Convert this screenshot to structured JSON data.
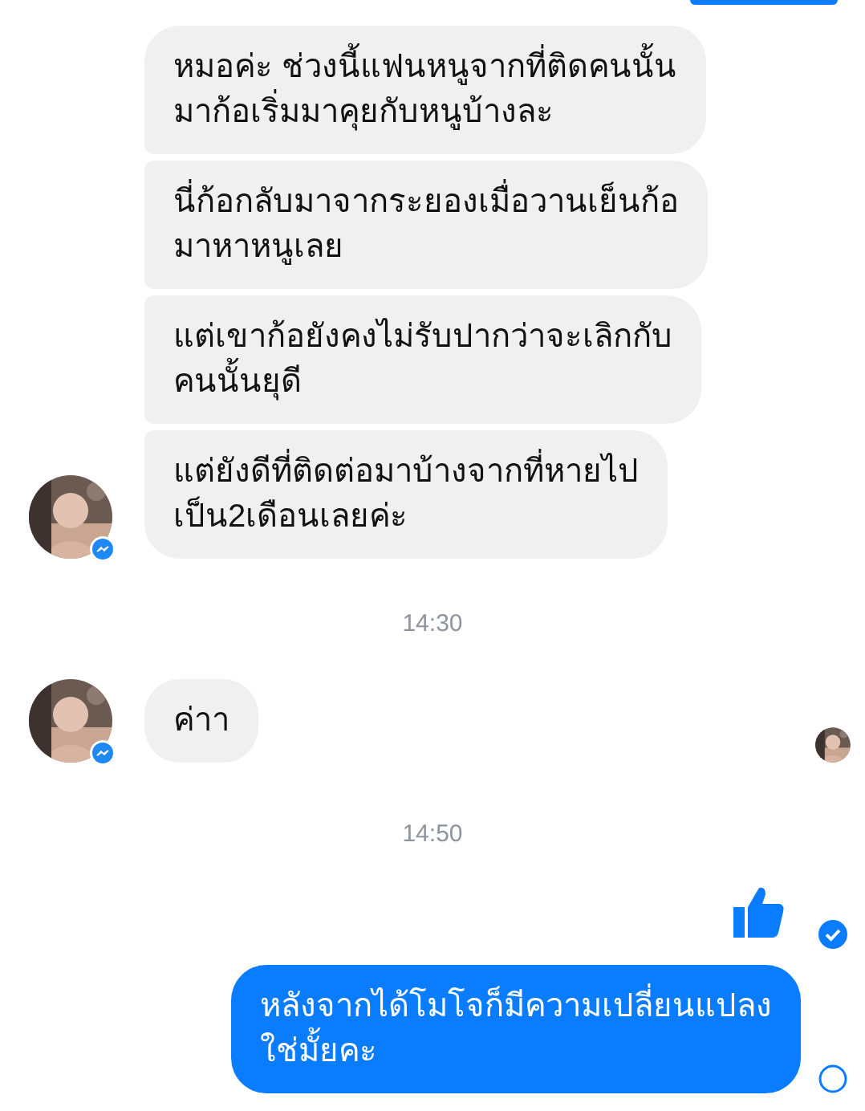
{
  "thread": [
    {
      "kind": "incoming",
      "texts": [
        "หมอค่ะ ช่วงนี้แฟนหนูจากที่ติดคนนั้น\nมาก้อเริ่มมาคุยกับหนูบ้างละ",
        "นี่ก้อกลับมาจากระยองเมื่อวานเย็นก้อ\nมาหาหนูเลย",
        "แต่เขาก้อยังคงไม่รับปากว่าจะเลิกกับ\nคนนั้นยุดี",
        "แต่ยังดีที่ติดต่อมาบ้างจากที่หายไป\nเป็น2เดือนเลยค่ะ"
      ],
      "seen_avatar": false
    },
    {
      "kind": "time",
      "text": "14:30"
    },
    {
      "kind": "incoming",
      "texts": [
        "ค่าา"
      ],
      "seen_avatar": true
    },
    {
      "kind": "time",
      "text": "14:50"
    },
    {
      "kind": "like",
      "delivered": true
    },
    {
      "kind": "outgoing",
      "texts": [
        "หลังจากได้โมโจก็มีความเปลี่ยนแปลง\nใช่มั้ยคะ"
      ],
      "delivered": false
    }
  ]
}
